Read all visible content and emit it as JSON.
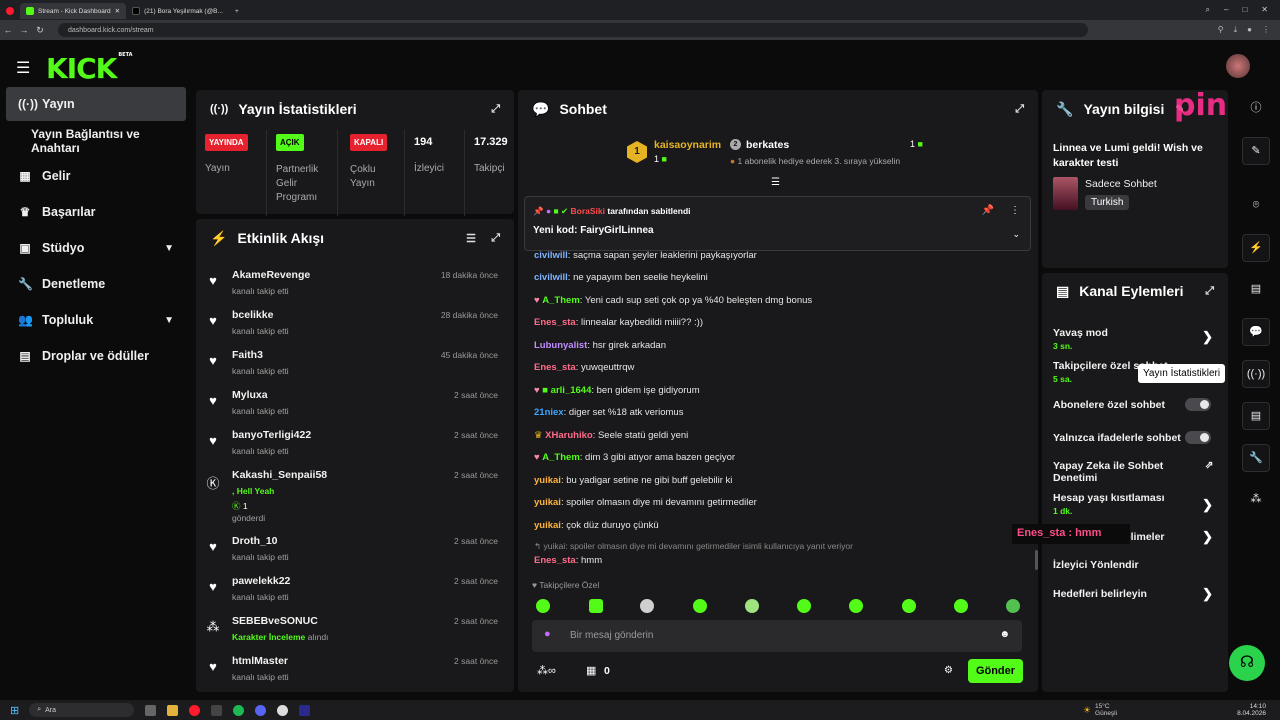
{
  "browser": {
    "tabs": [
      {
        "label": "Stream - Kick Dashboard"
      },
      {
        "label": "(21) Bora Yeşilırmak (@B..."
      }
    ],
    "url": "dashboard.kick.com/stream"
  },
  "app": {
    "logo": "KICK",
    "logo_tag": "BETA"
  },
  "sidebar": {
    "items": [
      {
        "label": "Yayın",
        "icon": "broadcast-icon"
      },
      {
        "label": "Yayın Bağlantısı ve Anahtarı",
        "icon": ""
      },
      {
        "label": "Gelir",
        "icon": "chart-icon"
      },
      {
        "label": "Başarılar",
        "icon": "trophy-icon"
      },
      {
        "label": "Stüdyo",
        "icon": "studio-icon"
      },
      {
        "label": "Denetleme",
        "icon": "wrench-icon"
      },
      {
        "label": "Topluluk",
        "icon": "people-icon"
      },
      {
        "label": "Droplar ve ödüller",
        "icon": "gift-icon"
      }
    ]
  },
  "stats": {
    "title": "Yayın İstatistikleri",
    "items": [
      {
        "badge": "YAYINDA",
        "label": "Yayın",
        "badge_color": "#e5222e"
      },
      {
        "badge": "AÇIK",
        "label": "Partnerlik Gelir Programı",
        "badge_color": "#53fc18"
      },
      {
        "badge": "KAPALI",
        "label": "Çoklu Yayın",
        "badge_color": "#e5222e"
      },
      {
        "value": "194",
        "label": "İzleyici"
      },
      {
        "value": "17.329",
        "label": "Takipçi"
      }
    ]
  },
  "activity": {
    "title": "Etkinlik Akışı",
    "items": [
      {
        "name": "AkameRevenge",
        "sub": "kanalı takip etti",
        "time": "18 dakika önce"
      },
      {
        "name": "bcelikke",
        "sub": "kanalı takip etti",
        "time": "28 dakika önce"
      },
      {
        "name": "Faith3",
        "sub": "kanalı takip etti",
        "time": "45 dakika önce"
      },
      {
        "name": "Myluxa",
        "sub": "kanalı takip etti",
        "time": "2 saat önce"
      },
      {
        "name": "banyoTerligi422",
        "sub": "kanalı takip etti",
        "time": "2 saat önce"
      },
      {
        "name": "Kakashi_Senpaii58",
        "msg": ", Hell Yeah",
        "count": "1",
        "sub": "gönderdi",
        "time": "2 saat önce"
      },
      {
        "name": "Droth_10",
        "sub": "kanalı takip etti",
        "time": "2 saat önce"
      },
      {
        "name": "pawelekk22",
        "sub": "kanalı takip etti",
        "time": "2 saat önce"
      },
      {
        "name": "SEBEBveSONUC",
        "reward": "Karakter İnceleme",
        "sub": "alındı",
        "time": "2 saat önce"
      },
      {
        "name": "htmlMaster",
        "sub": "kanalı takip etti",
        "time": "2 saat önce"
      }
    ]
  },
  "chat": {
    "title": "Sohbet",
    "top_gifters": [
      {
        "rank": "1",
        "name": "kaisaoynarim",
        "count": "1"
      },
      {
        "rank": "2",
        "name": "berkates",
        "count": "1"
      }
    ],
    "promo": "1 abonelik hediye ederek 3. sıraya yükselin",
    "pinned": {
      "by_user": "BoraSiki",
      "by_text": "tarafından sabitlendi",
      "message": "Yeni kod: FairyGirlLinnea"
    },
    "messages": [
      {
        "user": "civilwill",
        "color": "#7fb3ff",
        "text": "saçma sapan şeyler leaklerini paykaşıyorlar"
      },
      {
        "user": "civilwill",
        "color": "#7fb3ff",
        "text": "ne yapayım ben seelie heykelini"
      },
      {
        "user": "A_Them",
        "color": "#53fc18",
        "text": "Yeni cadı sup seti çok op ya %40 beleşten dmg bonus"
      },
      {
        "user": "Enes_sta",
        "color": "#ff6b8a",
        "text": "linnealar kaybedildi miiii?? :))"
      },
      {
        "user": "Lubunyalist",
        "color": "#c18cff",
        "text": "hsr girek arkadan"
      },
      {
        "user": "Enes_sta",
        "color": "#ff6b8a",
        "text": "yuwqeuttrqw"
      },
      {
        "user": "arli_1644",
        "color": "#53fc18",
        "text": "ben gidem işe gidiyorum"
      },
      {
        "user": "21niex",
        "color": "#3da7ff",
        "text": "diger set %18 atk veriomus"
      },
      {
        "user": "XHaruhiko",
        "color": "#ff6b8a",
        "text": "Seele statü geldi yeni"
      },
      {
        "user": "A_Them",
        "color": "#53fc18",
        "text": "dim 3 gibi atıyor ama bazen geçiyor"
      },
      {
        "user": "yuikai",
        "color": "#ffb43d",
        "text": "bu yadigar setine ne gibi buff gelebilir ki"
      },
      {
        "user": "yuikai",
        "color": "#ffb43d",
        "text": "spoiler olmasın diye mi devamını getirmediler"
      },
      {
        "user": "yuikai",
        "color": "#ffb43d",
        "text": "çok düz duruyo çünkü"
      }
    ],
    "reply_context": "yuikai: spoiler olmasın diye mi devamını getirmediler isimli kullanıcıya yanıt veriyor",
    "last_message": {
      "user": "Enes_sta",
      "text": "hmm"
    },
    "mode_label": "Takipçilere Özel",
    "input_placeholder": "Bir mesaj gönderin",
    "points": "0",
    "send_label": "Gönder"
  },
  "stream_info": {
    "title": "Yayın bilgisi",
    "stream_title": "Linnea ve Lumi geldi! Wish ve karakter testi",
    "category": "Sadece Sohbet",
    "language": "Turkish"
  },
  "channel_actions": {
    "title": "Kanal Eylemleri",
    "items": [
      {
        "label": "Yavaş mod",
        "value": "3 sn.",
        "kind": "arrow"
      },
      {
        "label": "Takipçilere özel sohbet",
        "value": "5 sa.",
        "kind": "arrow"
      },
      {
        "label": "Abonelere özel sohbet",
        "value": "",
        "kind": "toggle"
      },
      {
        "label": "Yalnızca ifadelerle sohbet",
        "value": "",
        "kind": "toggle"
      },
      {
        "label": "Yapay Zeka ile Sohbet Denetimi",
        "value": "",
        "kind": "external"
      },
      {
        "label": "Hesap yaşı kısıtlaması",
        "value": "1 dk.",
        "kind": "arrow"
      },
      {
        "label": "Yasaklanmış kelimeler",
        "value": "",
        "kind": "arrow"
      },
      {
        "label": "İzleyici Yönlendir",
        "value": "",
        "kind": "none"
      },
      {
        "label": "Hedefleri belirleyin",
        "value": "",
        "kind": "arrow"
      }
    ]
  },
  "tooltip": "Yayın İstatistikleri",
  "overlay": {
    "chat_popup": "Enes_sta : hmm",
    "watermark": "pin"
  },
  "taskbar": {
    "search": "Ara",
    "weather_temp": "15°C",
    "weather_text": "Güneşli",
    "time": "14:10",
    "date": "8.04.2026"
  },
  "colors": {
    "accent": "#53fc18",
    "live": "#e5222e",
    "panel": "#19191b"
  }
}
